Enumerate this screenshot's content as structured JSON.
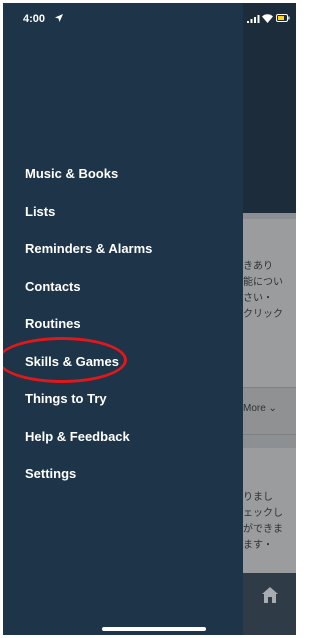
{
  "status_bar": {
    "time": "4:00",
    "location_icon": "location-arrow-icon",
    "signal_icon": "cellular-signal-icon",
    "wifi_icon": "wifi-icon",
    "battery_icon": "battery-icon"
  },
  "drawer": {
    "menu_items": [
      {
        "label": "Music & Books"
      },
      {
        "label": "Lists"
      },
      {
        "label": "Reminders & Alarms"
      },
      {
        "label": "Contacts"
      },
      {
        "label": "Routines"
      },
      {
        "label": "Skills & Games"
      },
      {
        "label": "Things to Try"
      },
      {
        "label": "Help & Feedback"
      },
      {
        "label": "Settings"
      }
    ],
    "highlighted_item": "Skills & Games",
    "highlight_color": "#e0181b"
  },
  "background": {
    "card1_lines": "きあり\n能につい\nさい・\nクリック",
    "more_label": "More  ⌄",
    "card3_lines": "りまし\nェックし\nができま\nます・",
    "tab_icon": "home-icon"
  },
  "colors": {
    "drawer_bg": "#1d3449",
    "text": "#ffffff"
  }
}
